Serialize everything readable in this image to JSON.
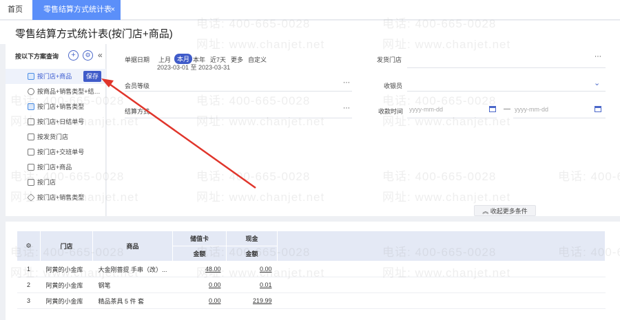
{
  "tabs": {
    "home": "首页",
    "active": "零售结算方式统计表",
    "close": "×"
  },
  "page_title": "零售结算方式统计表(按门店+商品)",
  "scheme": {
    "heading": "按以下方案查询",
    "add": "+",
    "settings": "⚙",
    "collapse": "«",
    "save": "保存",
    "items": [
      {
        "label": "按门店+商品",
        "icon": "grid-icon"
      },
      {
        "label": "按商品+销售类型+结…",
        "icon": "clock-icon"
      },
      {
        "label": "按门店+销售类型",
        "icon": "grid-icon"
      },
      {
        "label": "按门店+日结单号",
        "icon": "table-icon"
      },
      {
        "label": "按发货门店",
        "icon": "store-icon"
      },
      {
        "label": "按门店+交班单号",
        "icon": "bar-chart-icon"
      },
      {
        "label": "按门店+商品",
        "icon": "table-icon"
      },
      {
        "label": "按门店",
        "icon": "line-chart-icon"
      },
      {
        "label": "按门店+销售类型",
        "icon": "cube-icon"
      }
    ]
  },
  "filters": {
    "doc_date": "单据日期",
    "periods": [
      "上月",
      "本月",
      "本年",
      "近7天",
      "更多",
      "自定义"
    ],
    "range": "2023-03-01 至 2023-03-31",
    "ship_store": "发货门店",
    "member_level": "会员等级",
    "cashier": "收银员",
    "settle_method": "结算方式",
    "pay_time": "收款时间",
    "date_placeholder": "yyyy-mm-dd",
    "dash": "—",
    "more": "⋯",
    "collapse_more": "收起更多条件"
  },
  "table": {
    "headers": {
      "store": "门店",
      "product": "商品",
      "stored_card": "储值卡",
      "cash": "现金",
      "amount": "金额"
    },
    "rows": [
      {
        "no": "1",
        "store": "阿黄的小金库",
        "product": "大金刚蔷提 手串（改）...",
        "card": "48.00",
        "cash": "0.00"
      },
      {
        "no": "2",
        "store": "阿黄的小金库",
        "product": "钢笔",
        "card": "0.00",
        "cash": "0.01"
      },
      {
        "no": "3",
        "store": "阿黄的小金库",
        "product": "精品茶具 5 件 套",
        "card": "0.00",
        "cash": "219.99"
      }
    ]
  },
  "watermark": {
    "phone": "电话: 400-665-0028",
    "site": "网址: www.chanjet.net"
  },
  "colors": {
    "accent": "#3f5bc9",
    "tab": "#5b8ff9",
    "arrow": "#e0352b"
  }
}
